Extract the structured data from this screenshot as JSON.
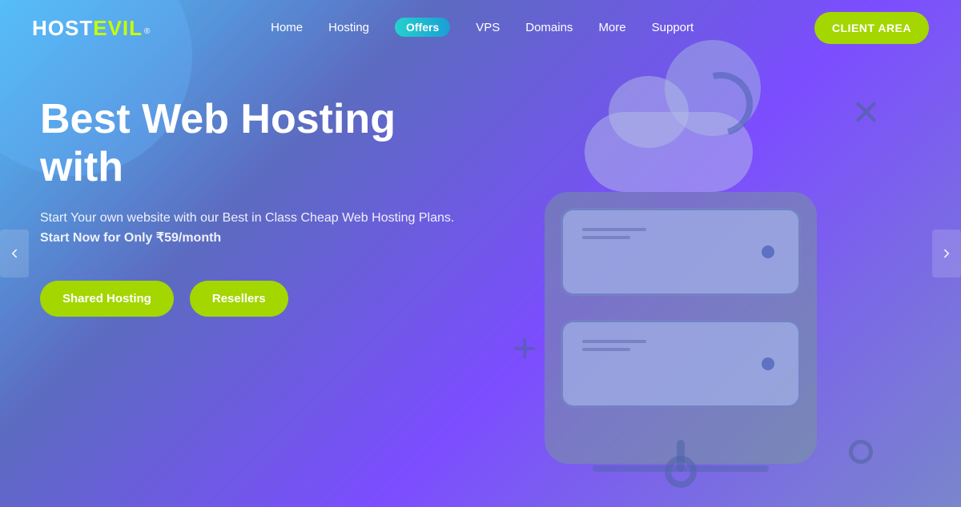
{
  "logo": {
    "host": "HOST",
    "evil": "EVIL",
    "dot": "®"
  },
  "nav": {
    "items": [
      {
        "label": "Home",
        "id": "home"
      },
      {
        "label": "Hosting",
        "id": "hosting"
      },
      {
        "label": "Offers",
        "id": "offers",
        "badge": true
      },
      {
        "label": "VPS",
        "id": "vps"
      },
      {
        "label": "Domains",
        "id": "domains"
      },
      {
        "label": "More",
        "id": "more"
      },
      {
        "label": "Support",
        "id": "support"
      }
    ],
    "client_area": "CLIENT AREA"
  },
  "hero": {
    "title_line1": "Best Web Hosting",
    "title_line2": "with",
    "subtitle_line1": "Start Your own website with our Best in Class Cheap Web Hosting Plans.",
    "subtitle_line2": "Start Now for Only ₹59/month",
    "btn_shared": "Shared Hosting",
    "btn_resellers": "Resellers"
  },
  "arrows": {
    "left": "‹",
    "right": "›"
  }
}
